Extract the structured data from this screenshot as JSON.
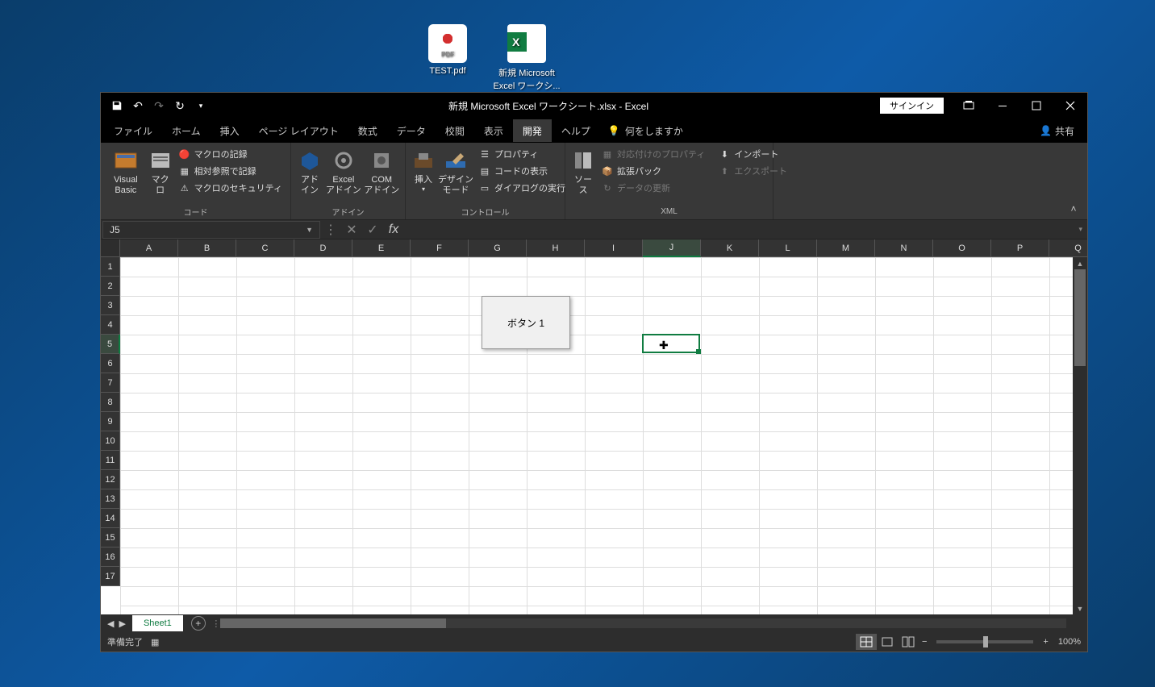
{
  "desktop": {
    "icons": [
      {
        "label": "TEST.pdf",
        "type": "pdf"
      },
      {
        "label": "新規 Microsoft Excel ワークシ...",
        "type": "xlsx"
      }
    ]
  },
  "titlebar": {
    "title": "新規 Microsoft Excel ワークシート.xlsx  -  Excel",
    "signin": "サインイン"
  },
  "tabs": {
    "file": "ファイル",
    "home": "ホーム",
    "insert": "挿入",
    "layout": "ページ レイアウト",
    "formulas": "数式",
    "data": "データ",
    "review": "校閲",
    "view": "表示",
    "developer": "開発",
    "help": "ヘルプ",
    "tellme": "何をしますか",
    "share": "共有"
  },
  "ribbon": {
    "code": {
      "vb": "Visual Basic",
      "macro": "マクロ",
      "record": "マクロの記録",
      "relref": "相対参照で記録",
      "security": "マクロのセキュリティ",
      "label": "コード"
    },
    "addins": {
      "addin": "アド\nイン",
      "excel": "Excel\nアドイン",
      "com": "COM\nアドイン",
      "label": "アドイン"
    },
    "controls": {
      "insert": "挿入",
      "design": "デザイン\nモード",
      "properties": "プロパティ",
      "viewcode": "コードの表示",
      "dialog": "ダイアログの実行",
      "label": "コントロール"
    },
    "xml": {
      "source": "ソース",
      "mapprops": "対応付けのプロパティ",
      "expansion": "拡張パック",
      "refresh": "データの更新",
      "import": "インポート",
      "export": "エクスポート",
      "label": "XML"
    }
  },
  "formula": {
    "namebox": "J5"
  },
  "grid": {
    "cols": [
      "A",
      "B",
      "C",
      "D",
      "E",
      "F",
      "G",
      "H",
      "I",
      "J",
      "K",
      "L",
      "M",
      "N",
      "O",
      "P",
      "Q"
    ],
    "rows": [
      "1",
      "2",
      "3",
      "4",
      "5",
      "6",
      "7",
      "8",
      "9",
      "10",
      "11",
      "12",
      "13",
      "14",
      "15",
      "16",
      "17"
    ],
    "selected_col": "J",
    "selected_row": "5",
    "button_label": "ボタン 1"
  },
  "sheets": {
    "tab1": "Sheet1"
  },
  "status": {
    "ready": "準備完了",
    "zoom": "100%"
  }
}
